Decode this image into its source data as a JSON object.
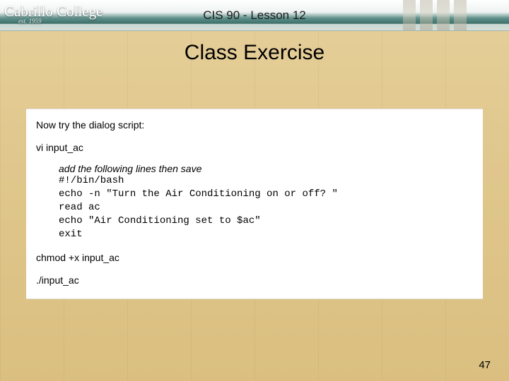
{
  "header": {
    "logo_text": "Cabrillo College",
    "est_text": "est. 1959",
    "lesson_label": "CIS 90 - Lesson 12"
  },
  "title": "Class Exercise",
  "content": {
    "intro": "Now try the dialog script:",
    "cmd_vi": "vi input_ac",
    "instruction": "add the following lines then save",
    "code": "#!/bin/bash\necho -n \"Turn the Air Conditioning on or off? \"\nread ac\necho \"Air Conditioning set to $ac\"\nexit",
    "cmd_chmod": "chmod +x input_ac",
    "cmd_run": "./input_ac"
  },
  "page_number": "47"
}
